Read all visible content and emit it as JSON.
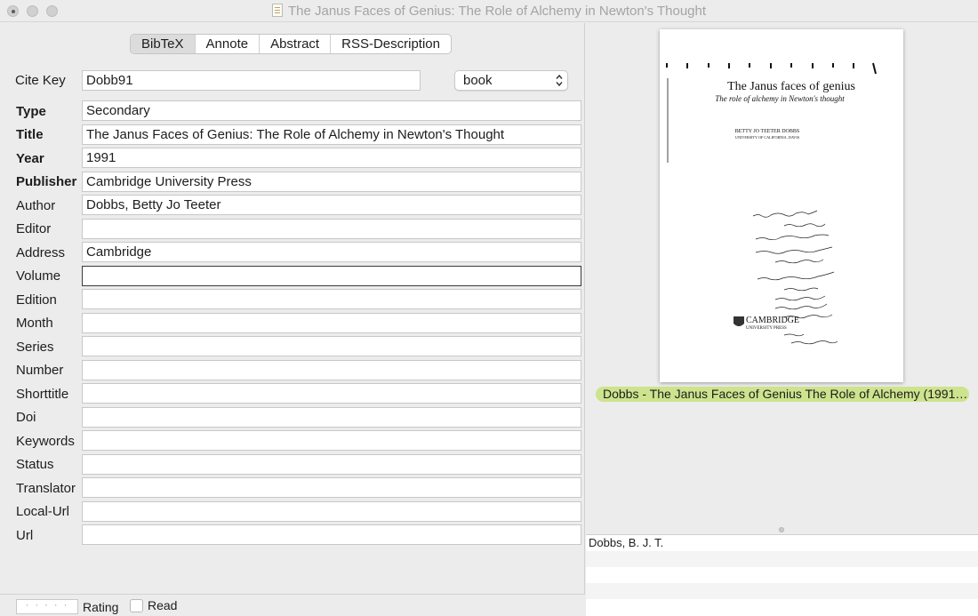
{
  "window": {
    "title": "The Janus Faces of Genius: The Role of Alchemy in Newton's Thought"
  },
  "tabs": [
    {
      "label": "BibTeX",
      "active": true
    },
    {
      "label": "Annote",
      "active": false
    },
    {
      "label": "Abstract",
      "active": false
    },
    {
      "label": "RSS-Description",
      "active": false
    }
  ],
  "citekey": {
    "label": "Cite Key",
    "value": "Dobb91",
    "type_value": "book"
  },
  "fields": [
    {
      "label": "Type",
      "value": "Secondary",
      "bold": true
    },
    {
      "label": "Title",
      "value": "The Janus Faces of Genius: The Role of Alchemy in Newton's Thought",
      "bold": true
    },
    {
      "label": "Year",
      "value": "1991",
      "bold": true
    },
    {
      "label": "Publisher",
      "value": "Cambridge University Press",
      "bold": true
    },
    {
      "label": "Author",
      "value": "Dobbs, Betty Jo Teeter",
      "bold": false
    },
    {
      "label": "Editor",
      "value": "",
      "bold": false
    },
    {
      "label": "Address",
      "value": "Cambridge",
      "bold": false
    },
    {
      "label": "Volume",
      "value": "",
      "bold": false,
      "focused": true
    },
    {
      "label": "Edition",
      "value": "",
      "bold": false
    },
    {
      "label": "Month",
      "value": "",
      "bold": false
    },
    {
      "label": "Series",
      "value": "",
      "bold": false
    },
    {
      "label": "Number",
      "value": "",
      "bold": false
    },
    {
      "label": "Shorttitle",
      "value": "",
      "bold": false
    },
    {
      "label": "Doi",
      "value": "",
      "bold": false
    },
    {
      "label": "Keywords",
      "value": "",
      "bold": false
    },
    {
      "label": "Status",
      "value": "",
      "bold": false
    },
    {
      "label": "Translator",
      "value": "",
      "bold": false
    },
    {
      "label": "Local-Url",
      "value": "",
      "bold": false
    },
    {
      "label": "Url",
      "value": "",
      "bold": false
    }
  ],
  "bottom": {
    "rating_dots": "· · · · ·",
    "rating_label": "Rating",
    "read_label": "Read"
  },
  "preview": {
    "title": "The Janus faces of genius",
    "subtitle": "The role of alchemy in Newton's thought",
    "author": "BETTY JO TEETER DOBBS",
    "affiliation": "UNIVERSITY OF CALIFORNIA, DAVIS",
    "publisher_line1": "CAMBRIDGE",
    "publisher_line2": "UNIVERSITY PRESS"
  },
  "file": {
    "name": "Dobbs - The Janus Faces of Genius The Role of Alchemy (1991…"
  },
  "notes": {
    "author_short": "Dobbs, B. J. T."
  }
}
